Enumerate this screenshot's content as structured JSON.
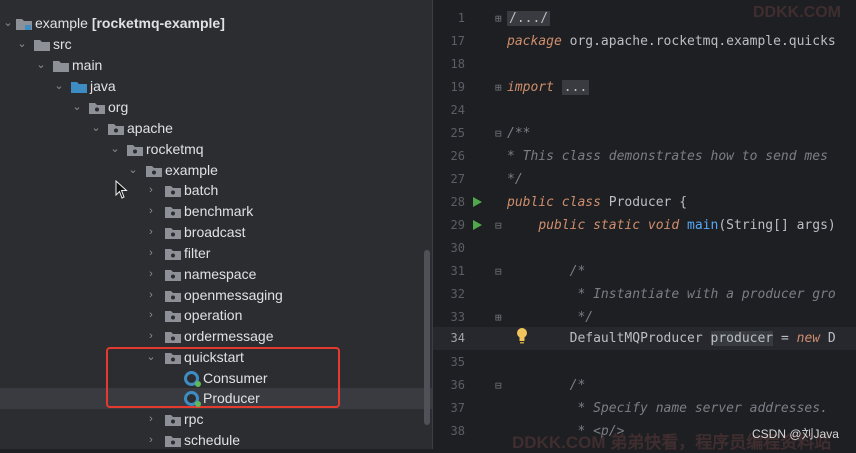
{
  "tree": {
    "root": {
      "name": "example",
      "module": "[rocketmq-example]"
    },
    "items": [
      {
        "label": "src",
        "kind": "folder"
      },
      {
        "label": "main",
        "kind": "folder"
      },
      {
        "label": "java",
        "kind": "source-folder"
      },
      {
        "label": "org",
        "kind": "package"
      },
      {
        "label": "apache",
        "kind": "package"
      },
      {
        "label": "rocketmq",
        "kind": "package"
      },
      {
        "label": "example",
        "kind": "package"
      },
      {
        "label": "batch",
        "kind": "package"
      },
      {
        "label": "benchmark",
        "kind": "package"
      },
      {
        "label": "broadcast",
        "kind": "package"
      },
      {
        "label": "filter",
        "kind": "package"
      },
      {
        "label": "namespace",
        "kind": "package"
      },
      {
        "label": "openmessaging",
        "kind": "package"
      },
      {
        "label": "operation",
        "kind": "package"
      },
      {
        "label": "ordermessage",
        "kind": "package"
      },
      {
        "label": "quickstart",
        "kind": "package"
      },
      {
        "label": "Consumer",
        "kind": "class"
      },
      {
        "label": "Producer",
        "kind": "class",
        "selected": true
      },
      {
        "label": "rpc",
        "kind": "package"
      },
      {
        "label": "schedule",
        "kind": "package"
      }
    ]
  },
  "editor": {
    "lines": [
      {
        "num": "1",
        "text": "/.../"
      },
      {
        "num": "17",
        "text": "package org.apache.rocketmq.example.quicks"
      },
      {
        "num": "18",
        "text": ""
      },
      {
        "num": "19",
        "text": "import ..."
      },
      {
        "num": "24",
        "text": ""
      },
      {
        "num": "25",
        "text": "/**"
      },
      {
        "num": "26",
        "text": " * This class demonstrates how to send mes"
      },
      {
        "num": "27",
        "text": " */"
      },
      {
        "num": "28",
        "text": "public class Producer {"
      },
      {
        "num": "29",
        "text": "    public static void main(String[] args)"
      },
      {
        "num": "30",
        "text": ""
      },
      {
        "num": "31",
        "text": "        /*"
      },
      {
        "num": "32",
        "text": "         * Instantiate with a producer gro"
      },
      {
        "num": "33",
        "text": "         */"
      },
      {
        "num": "34",
        "text": "        DefaultMQProducer producer = new D"
      },
      {
        "num": "35",
        "text": ""
      },
      {
        "num": "36",
        "text": "        /*"
      },
      {
        "num": "37",
        "text": "         * Specify name server addresses."
      },
      {
        "num": "38",
        "text": "         * <p/>"
      }
    ]
  },
  "watermarks": {
    "top": "DDKK.COM",
    "bottom": "DDKK.COM 弟弟快看，程序员编程资料站",
    "csdn": "CSDN @刘Java"
  },
  "colors": {
    "highlight_box": "#e53a2f",
    "selected_row": "#2e436e",
    "keyword": "#cf8e6d",
    "comment": "#7a7e85",
    "method": "#56a8f5"
  }
}
